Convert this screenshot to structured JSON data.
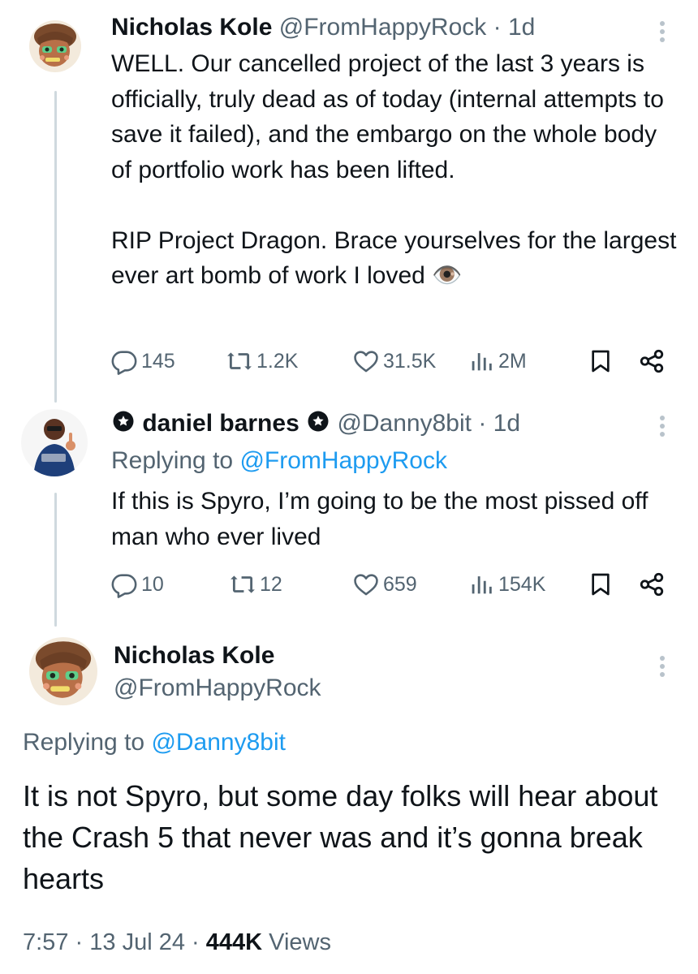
{
  "tweets": [
    {
      "name": "Nicholas Kole",
      "handle": "@FromHappyRock",
      "separator": "·",
      "time": "1d",
      "text_paragraphs": [
        "WELL. Our cancelled project of the last 3 years is officially, truly dead as of today (internal attempts to save it failed), and the embargo on the whole body of portfolio work has been lifted.",
        "RIP Project Dragon. Brace yourselves for the largest ever art bomb of work I loved 👁️"
      ],
      "stats": {
        "replies": "145",
        "reposts": "1.2K",
        "likes": "31.5K",
        "views": "2M"
      }
    },
    {
      "name": "daniel barnes",
      "handle": "@Danny8bit",
      "separator": "·",
      "time": "1d",
      "replying_prefix": "Replying to",
      "replying_handle": "@FromHappyRock",
      "text": "If this is Spyro, I’m going to be the most pissed off man who ever lived",
      "stats": {
        "replies": "10",
        "reposts": "12",
        "likes": "659",
        "views": "154K"
      }
    }
  ],
  "main_tweet": {
    "name": "Nicholas Kole",
    "handle": "@FromHappyRock",
    "replying_prefix": "Replying to",
    "replying_handle": "@Danny8bit",
    "text": "It is not Spyro, but some day folks will hear about the Crash 5 that never was and it’s gonna break hearts",
    "time": "7:57",
    "date": "13 Jul 24",
    "views_count": "444K",
    "views_label": "Views",
    "separator": "·"
  },
  "colors": {
    "accent": "#1d9bf0",
    "secondary_text": "#536471",
    "primary_text": "#0f1419",
    "thread_line": "#cfd9de"
  },
  "icons": [
    "reply-icon",
    "repost-icon",
    "like-icon",
    "views-icon",
    "bookmark-icon",
    "share-icon",
    "more-icon",
    "verified-icon",
    "eye-emoji"
  ]
}
